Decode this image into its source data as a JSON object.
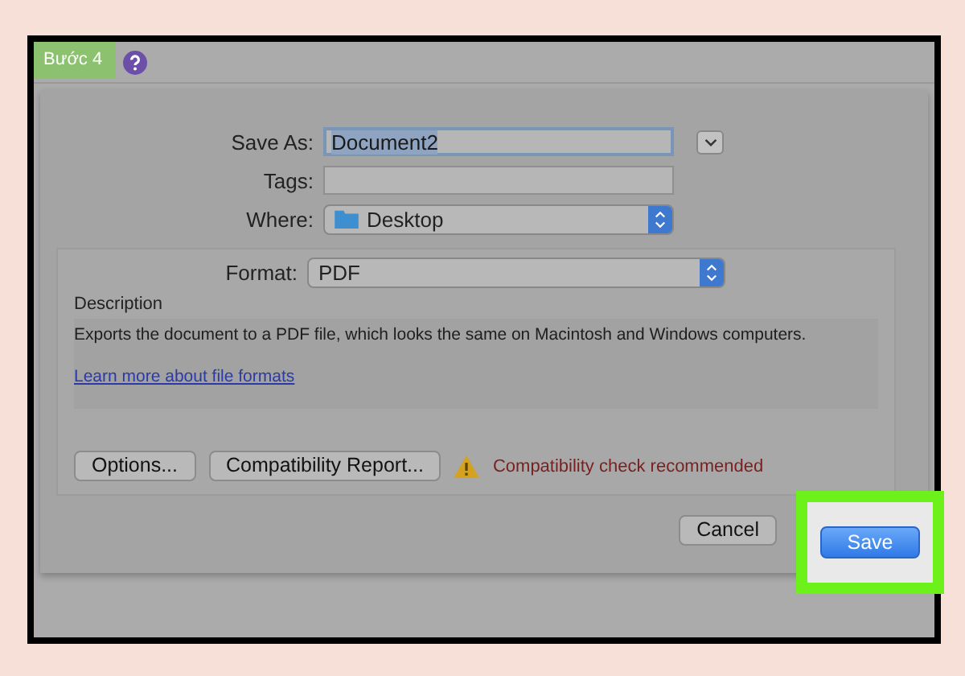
{
  "step_label": "Bước 4",
  "save_as": {
    "label": "Save As:",
    "value": "Document2"
  },
  "tags": {
    "label": "Tags:"
  },
  "where": {
    "label": "Where:",
    "value": "Desktop"
  },
  "format": {
    "label": "Format:",
    "value": "PDF"
  },
  "description": {
    "heading": "Description",
    "text": "Exports the document to a PDF file, which looks the same on Macintosh and Windows computers.",
    "link": "Learn more about file formats"
  },
  "options_button": "Options...",
  "report_button": "Compatibility Report...",
  "warning": "Compatibility check recommended",
  "cancel_button": "Cancel",
  "save_button": "Save"
}
